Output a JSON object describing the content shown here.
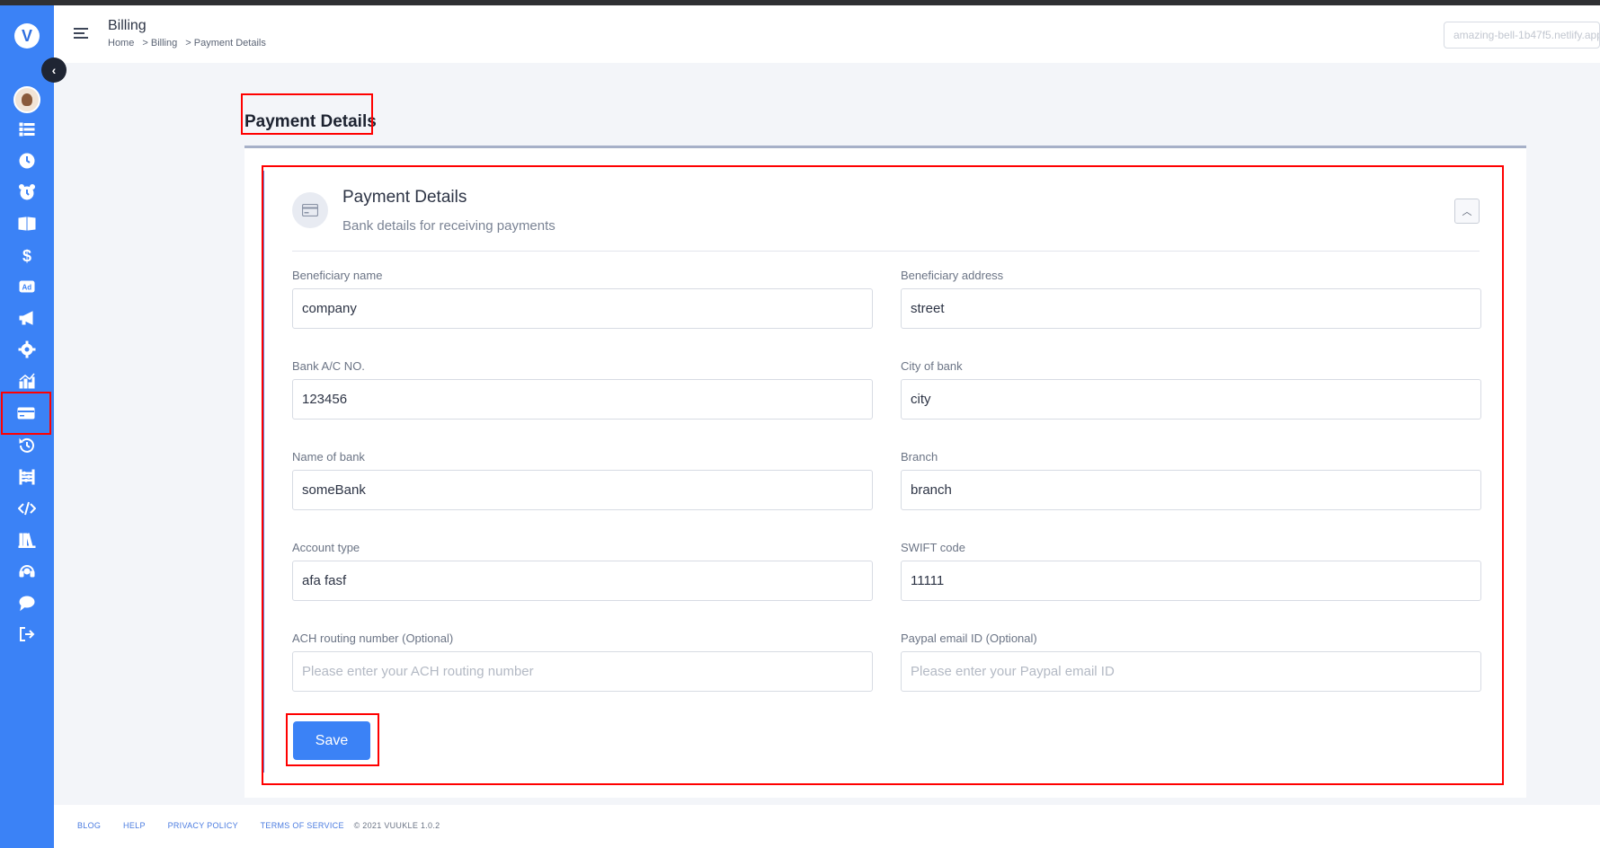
{
  "header": {
    "title": "Billing",
    "breadcrumb": [
      "Home",
      ">  Billing",
      ">  Payment Details"
    ],
    "domain": "amazing-bell-1b47f5.netlify.app"
  },
  "page": {
    "section_title": "Payment Details"
  },
  "card": {
    "title": "Payment Details",
    "subtitle": "Bank details for receiving payments",
    "collapse_icon": "chevron-up-icon"
  },
  "form": {
    "fields": [
      {
        "label": "Beneficiary name",
        "value": "company",
        "placeholder": ""
      },
      {
        "label": "Beneficiary address",
        "value": "street",
        "placeholder": ""
      },
      {
        "label": "Bank A/C NO.",
        "value": "123456",
        "placeholder": ""
      },
      {
        "label": "City of bank",
        "value": "city",
        "placeholder": ""
      },
      {
        "label": "Name of bank",
        "value": "someBank",
        "placeholder": ""
      },
      {
        "label": "Branch",
        "value": "branch",
        "placeholder": ""
      },
      {
        "label": "Account type",
        "value": "afa fasf",
        "placeholder": ""
      },
      {
        "label": "SWIFT code",
        "value": "11111",
        "placeholder": ""
      },
      {
        "label": "ACH routing number (Optional)",
        "value": "",
        "placeholder": "Please enter your ACH routing number"
      },
      {
        "label": "Paypal email ID (Optional)",
        "value": "",
        "placeholder": "Please enter your Paypal email ID"
      }
    ],
    "save_label": "Save"
  },
  "sidebar": {
    "logo_letter": "V",
    "items": [
      "list-icon",
      "clock-icon",
      "alarm-icon",
      "book-icon",
      "dollar-icon",
      "ad-icon",
      "megaphone-icon",
      "gear-icon",
      "chart-icon",
      "credit-card-icon",
      "history-icon",
      "abacus-icon",
      "code-icon",
      "library-icon",
      "headset-icon",
      "chat-icon",
      "logout-icon"
    ],
    "active_item": "credit-card-icon"
  },
  "footer": {
    "links": [
      "BLOG",
      "HELP",
      "PRIVACY POLICY",
      "TERMS OF SERVICE"
    ],
    "copyright": "© 2021 VUUKLE 1.0.2"
  },
  "colors": {
    "sidebar": "#3b82f6",
    "primary_button": "#3b82f6",
    "highlight": "#ff0000"
  }
}
